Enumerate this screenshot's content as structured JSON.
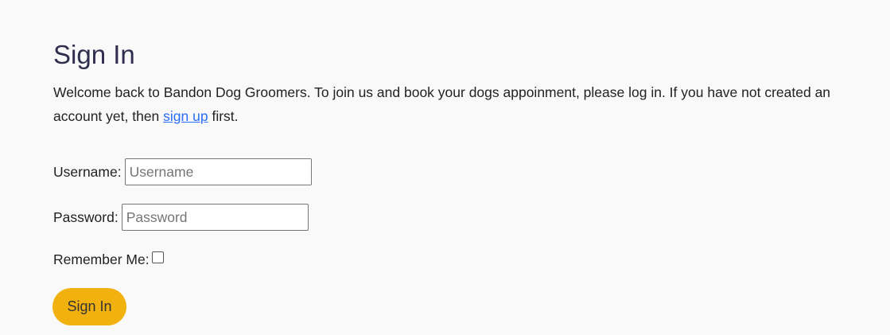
{
  "title": "Sign In",
  "intro": {
    "before": "Welcome back to Bandon Dog Groomers. To join us and book your dogs appoinment, please log in. If you have not created an account yet, then ",
    "link": "sign up",
    "after": " first."
  },
  "form": {
    "username_label": "Username:",
    "username_placeholder": "Username",
    "password_label": "Password:",
    "password_placeholder": "Password",
    "remember_label": "Remember Me:",
    "remember_checked": false,
    "submit_label": "Sign In"
  }
}
